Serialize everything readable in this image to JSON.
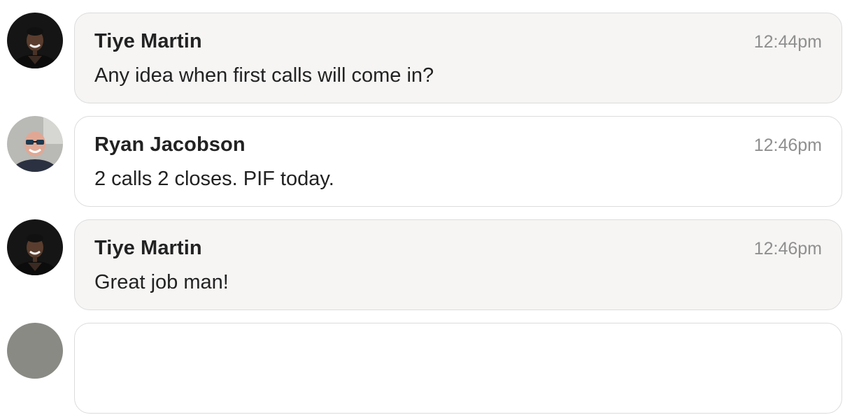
{
  "messages": [
    {
      "author": "Tiye Martin",
      "time": "12:44pm",
      "text": "Any idea when first calls will come in?",
      "avatar": "tiye-martin-avatar"
    },
    {
      "author": "Ryan Jacobson",
      "time": "12:46pm",
      "text": "2 calls 2 closes. PIF today.",
      "avatar": "ryan-jacobson-avatar"
    },
    {
      "author": "Tiye Martin",
      "time": "12:46pm",
      "text": "Great job man!",
      "avatar": "tiye-martin-avatar"
    }
  ],
  "colors": {
    "bubble_gray": "#f6f5f4",
    "bubble_white": "#ffffff",
    "border": "#dcdcdc",
    "timestamp": "#8f8f8f",
    "text": "#222222"
  }
}
